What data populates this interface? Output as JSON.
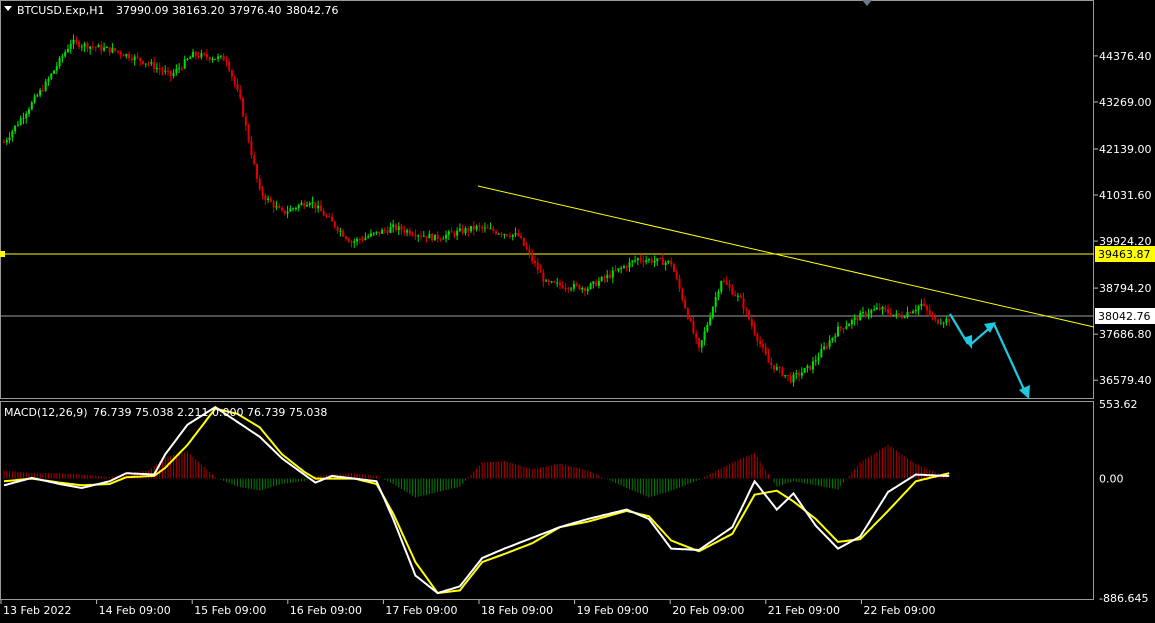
{
  "chart_header": {
    "symbol": "BTCUSD.Exp,H1",
    "open": "37990.09",
    "high": "38163.20",
    "low": "37976.40",
    "close": "38042.76"
  },
  "macd_header": {
    "name": "MACD(12,26,9)",
    "values": "76.739 75.038 2.211 0.000 76.739 75.038"
  },
  "colors": {
    "background": "#000000",
    "bull_candle": "#00e000",
    "bear_candle": "#e00000",
    "trendline": "#ffff00",
    "level_line": "#ffff00",
    "price_line": "#a0a0a0",
    "forecast_arrow": "#20c8e0",
    "macd_line": "#ffffff",
    "signal_line": "#ffff00",
    "hist_positive": "#b00000",
    "hist_negative": "#008000"
  },
  "chart_data": [
    {
      "type": "candlestick",
      "title": "BTCUSD.Exp,H1",
      "y_ticks": [
        "44376.40",
        "43269.00",
        "42139.00",
        "41031.60",
        "39924.20",
        "38794.20",
        "37686.80",
        "36579.40"
      ],
      "ylim": [
        36200,
        45600
      ],
      "x_ticks": [
        "13 Feb 2022",
        "14 Feb 09:00",
        "15 Feb 09:00",
        "16 Feb 09:00",
        "17 Feb 09:00",
        "18 Feb 09:00",
        "19 Feb 09:00",
        "20 Feb 09:00",
        "21 Feb 09:00",
        "22 Feb 09:00"
      ],
      "marked_levels": {
        "horizontal_level": "39463.87",
        "current_price": "38042.76"
      },
      "trendline_price_path": [
        [
          0,
          42300
        ],
        [
          15,
          43700
        ],
        [
          24,
          44700
        ],
        [
          40,
          44500
        ],
        [
          52,
          44200
        ],
        [
          60,
          43900
        ],
        [
          68,
          44400
        ],
        [
          80,
          44300
        ],
        [
          85,
          43300
        ],
        [
          92,
          41100
        ],
        [
          100,
          40600
        ],
        [
          110,
          40900
        ],
        [
          125,
          39900
        ],
        [
          140,
          40250
        ],
        [
          155,
          40000
        ],
        [
          170,
          40250
        ],
        [
          185,
          40050
        ],
        [
          195,
          38900
        ],
        [
          210,
          38800
        ],
        [
          228,
          39500
        ],
        [
          240,
          39400
        ],
        [
          250,
          37300
        ],
        [
          258,
          39000
        ],
        [
          265,
          38500
        ],
        [
          275,
          37000
        ],
        [
          283,
          36600
        ],
        [
          290,
          36900
        ],
        [
          300,
          37800
        ],
        [
          310,
          38200
        ],
        [
          315,
          38300
        ],
        [
          322,
          38100
        ],
        [
          330,
          38400
        ],
        [
          335,
          38000
        ],
        [
          340,
          38040
        ]
      ]
    },
    {
      "type": "macd",
      "title": "MACD(12,26,9)",
      "y_ticks": [
        "553.62",
        "0.00",
        "-886.645"
      ],
      "ylim": [
        -886.645,
        553.62
      ],
      "series": [
        {
          "name": "MACD",
          "points": [
            [
              0,
              -50
            ],
            [
              10,
              5
            ],
            [
              20,
              -40
            ],
            [
              28,
              -70
            ],
            [
              38,
              -20
            ],
            [
              44,
              40
            ],
            [
              54,
              30
            ],
            [
              58,
              180
            ],
            [
              66,
              400
            ],
            [
              76,
              530
            ],
            [
              84,
              420
            ],
            [
              92,
              310
            ],
            [
              100,
              150
            ],
            [
              108,
              30
            ],
            [
              112,
              -30
            ],
            [
              118,
              20
            ],
            [
              126,
              0
            ],
            [
              134,
              -20
            ],
            [
              140,
              -300
            ],
            [
              148,
              -720
            ],
            [
              156,
              -850
            ],
            [
              164,
              -800
            ],
            [
              172,
              -590
            ],
            [
              180,
              -520
            ],
            [
              190,
              -440
            ],
            [
              200,
              -360
            ],
            [
              210,
              -300
            ],
            [
              224,
              -230
            ],
            [
              232,
              -300
            ],
            [
              240,
              -520
            ],
            [
              250,
              -530
            ],
            [
              262,
              -360
            ],
            [
              270,
              -20
            ],
            [
              278,
              -230
            ],
            [
              284,
              -110
            ],
            [
              292,
              -350
            ],
            [
              300,
              -520
            ],
            [
              308,
              -430
            ],
            [
              318,
              -100
            ],
            [
              328,
              30
            ],
            [
              338,
              20
            ],
            [
              340,
              20
            ]
          ]
        },
        {
          "name": "Signal",
          "points": [
            [
              0,
              -20
            ],
            [
              10,
              0
            ],
            [
              20,
              -30
            ],
            [
              28,
              -50
            ],
            [
              38,
              -40
            ],
            [
              44,
              10
            ],
            [
              54,
              20
            ],
            [
              58,
              80
            ],
            [
              66,
              250
            ],
            [
              76,
              520
            ],
            [
              84,
              480
            ],
            [
              92,
              380
            ],
            [
              100,
              180
            ],
            [
              108,
              50
            ],
            [
              112,
              0
            ],
            [
              118,
              0
            ],
            [
              126,
              0
            ],
            [
              134,
              -40
            ],
            [
              140,
              -260
            ],
            [
              148,
              -620
            ],
            [
              156,
              -850
            ],
            [
              164,
              -830
            ],
            [
              172,
              -620
            ],
            [
              180,
              -560
            ],
            [
              190,
              -480
            ],
            [
              200,
              -360
            ],
            [
              210,
              -320
            ],
            [
              224,
              -240
            ],
            [
              232,
              -280
            ],
            [
              240,
              -460
            ],
            [
              250,
              -540
            ],
            [
              262,
              -410
            ],
            [
              270,
              -120
            ],
            [
              278,
              -90
            ],
            [
              284,
              -170
            ],
            [
              292,
              -300
            ],
            [
              300,
              -470
            ],
            [
              308,
              -450
            ],
            [
              318,
              -240
            ],
            [
              328,
              -20
            ],
            [
              338,
              30
            ],
            [
              340,
              40
            ]
          ]
        }
      ],
      "histogram_bars": [
        [
          0,
          60
        ],
        [
          10,
          40
        ],
        [
          20,
          40
        ],
        [
          28,
          30
        ],
        [
          38,
          10
        ],
        [
          44,
          40
        ],
        [
          52,
          60
        ],
        [
          58,
          160
        ],
        [
          66,
          200
        ],
        [
          76,
          10
        ],
        [
          84,
          -60
        ],
        [
          92,
          -90
        ],
        [
          100,
          -40
        ],
        [
          108,
          -20
        ],
        [
          112,
          20
        ],
        [
          118,
          30
        ],
        [
          126,
          40
        ],
        [
          134,
          20
        ],
        [
          140,
          -40
        ],
        [
          148,
          -140
        ],
        [
          156,
          -100
        ],
        [
          164,
          -60
        ],
        [
          172,
          120
        ],
        [
          180,
          130
        ],
        [
          190,
          70
        ],
        [
          200,
          110
        ],
        [
          210,
          60
        ],
        [
          224,
          -70
        ],
        [
          232,
          -140
        ],
        [
          240,
          -90
        ],
        [
          250,
          -10
        ],
        [
          262,
          120
        ],
        [
          270,
          190
        ],
        [
          278,
          -60
        ],
        [
          284,
          -20
        ],
        [
          292,
          -50
        ],
        [
          300,
          -80
        ],
        [
          308,
          120
        ],
        [
          318,
          250
        ],
        [
          328,
          110
        ],
        [
          338,
          20
        ],
        [
          340,
          0
        ]
      ]
    }
  ]
}
